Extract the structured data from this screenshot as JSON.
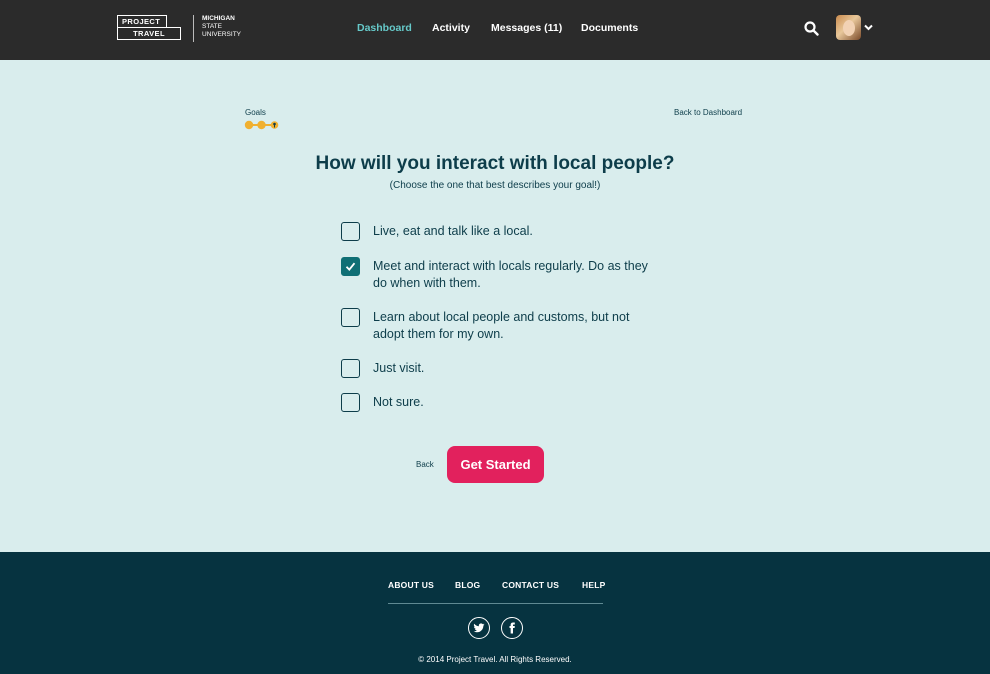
{
  "header": {
    "logo": {
      "word1": "PROJECT",
      "word2": "TRAVEL",
      "partner_line1": "MICHIGAN",
      "partner_line2": "STATE",
      "partner_line3": "UNIVERSITY"
    },
    "nav": [
      {
        "label": "Dashboard",
        "active": true
      },
      {
        "label": "Activity",
        "active": false
      },
      {
        "label": "Messages (11)",
        "active": false
      },
      {
        "label": "Documents",
        "active": false
      }
    ],
    "icons": {
      "search": "search-icon",
      "avatar": "user-avatar",
      "menu": "chevron-down-icon"
    }
  },
  "breadcrumb": {
    "step_label": "Goals",
    "progress": {
      "completed_steps": 2,
      "total_steps": 3
    },
    "back_link": "Back to Dashboard"
  },
  "question": {
    "title": "How will you interact with local people?",
    "subtitle": "(Choose the one that best describes your goal!)",
    "options": [
      {
        "line1": "Live, eat and talk like a local.",
        "line2": "",
        "checked": false
      },
      {
        "line1": "Meet and interact with locals regularly. Do as they",
        "line2": "do when with them.",
        "checked": true
      },
      {
        "line1": "Learn about local people and customs, but not",
        "line2": "adopt them for my own.",
        "checked": false
      },
      {
        "line1": "Just visit.",
        "line2": "",
        "checked": false
      },
      {
        "line1": "Not sure.",
        "line2": "",
        "checked": false
      }
    ]
  },
  "actions": {
    "back_label": "Back",
    "primary_label": "Get Started"
  },
  "footer": {
    "links": [
      "ABOUT US",
      "BLOG",
      "CONTACT US",
      "HELP"
    ],
    "social": [
      "twitter-icon",
      "facebook-icon"
    ],
    "copyright": "© 2014 Project Travel. All Rights Reserved."
  },
  "colors": {
    "header_bg": "#2b2b2b",
    "page_bg": "#d9eded",
    "text": "#0d3d4a",
    "nav_active": "#66c9c9",
    "checkbox_checked": "#0f6f75",
    "cta": "#e2215d",
    "progress": "#f0b030",
    "footer_bg": "#063340"
  }
}
